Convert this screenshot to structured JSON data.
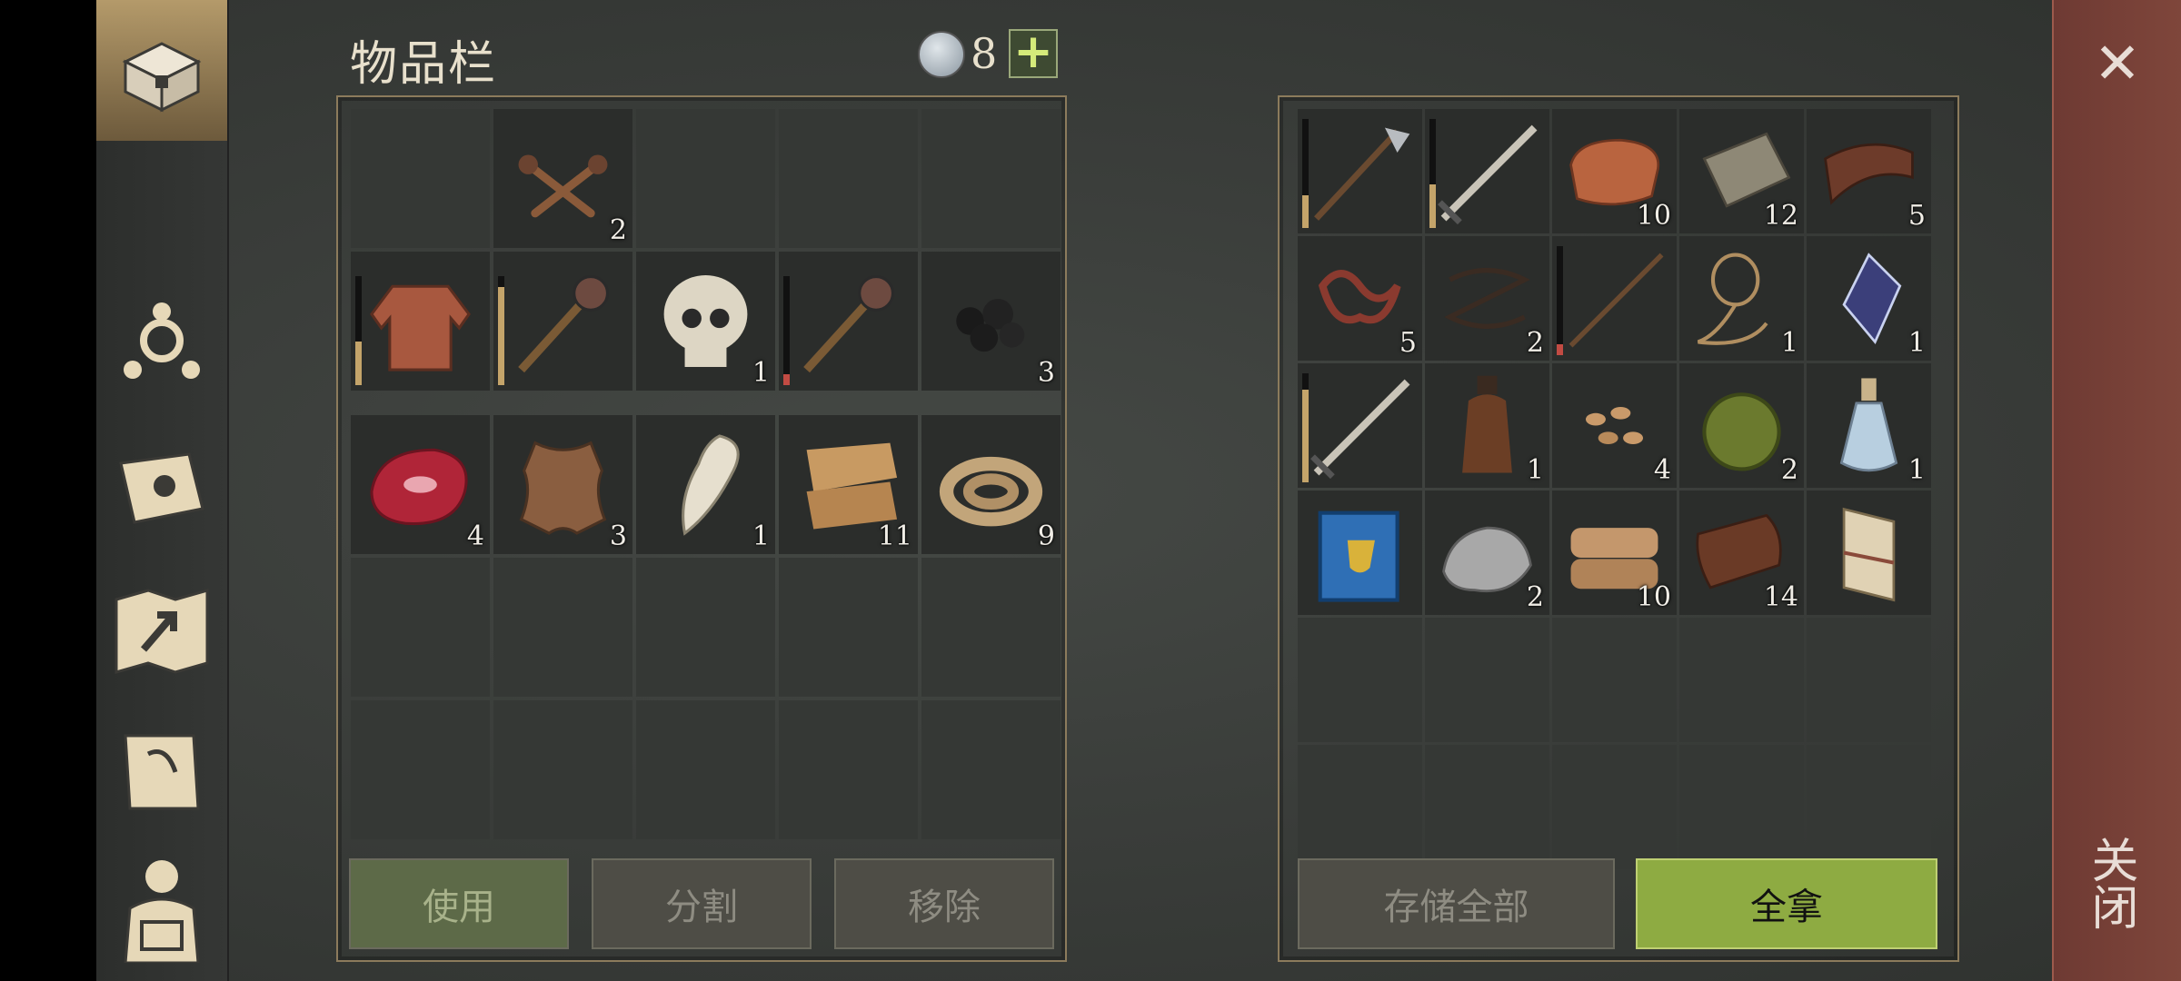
{
  "inventory": {
    "title": "物品栏",
    "currency_count": "8",
    "add_label": "+",
    "equipment_rows": [
      [
        {
          "icon": "empty"
        },
        {
          "icon": "nails-icon",
          "count": "2"
        },
        {
          "icon": "empty"
        },
        {
          "icon": "empty"
        },
        {
          "icon": "empty"
        }
      ],
      [
        {
          "icon": "chainmail-icon",
          "durability": 0.4
        },
        {
          "icon": "mace-icon",
          "durability": 0.9
        },
        {
          "icon": "skull-icon",
          "count": "1"
        },
        {
          "icon": "mace-icon",
          "durability": 0.1,
          "dur_color": "#c24b43"
        },
        {
          "icon": "coal-icon",
          "count": "3"
        }
      ]
    ],
    "bag_rows": [
      [
        {
          "icon": "raw-meat-icon",
          "count": "4"
        },
        {
          "icon": "hide-icon",
          "count": "3"
        },
        {
          "icon": "fang-icon",
          "count": "1"
        },
        {
          "icon": "cloth-icon",
          "count": "11"
        },
        {
          "icon": "rope-icon",
          "count": "9"
        }
      ],
      [
        {
          "icon": "empty"
        },
        {
          "icon": "empty"
        },
        {
          "icon": "empty"
        },
        {
          "icon": "empty"
        },
        {
          "icon": "empty"
        }
      ],
      [
        {
          "icon": "empty"
        },
        {
          "icon": "empty"
        },
        {
          "icon": "empty"
        },
        {
          "icon": "empty"
        },
        {
          "icon": "empty"
        }
      ]
    ],
    "buttons": {
      "use": "使用",
      "split": "分割",
      "remove": "移除"
    }
  },
  "storage": {
    "rows": [
      [
        {
          "icon": "halberd-icon",
          "durability": 0.3
        },
        {
          "icon": "sword-icon",
          "durability": 0.4
        },
        {
          "icon": "copper-ingot-icon",
          "count": "10"
        },
        {
          "icon": "wood-plank-icon",
          "count": "12"
        },
        {
          "icon": "leather-strip-icon",
          "count": "5"
        }
      ],
      [
        {
          "icon": "guts-icon",
          "count": "5"
        },
        {
          "icon": "wire-icon",
          "count": "2"
        },
        {
          "icon": "spear-icon",
          "durability": 0.1,
          "dur_color": "#c24b43"
        },
        {
          "icon": "lasso-icon",
          "count": "1"
        },
        {
          "icon": "crystal-icon",
          "count": "1"
        }
      ],
      [
        {
          "icon": "sword-icon",
          "durability": 0.85
        },
        {
          "icon": "bottle-icon",
          "count": "1"
        },
        {
          "icon": "seeds-icon",
          "count": "4"
        },
        {
          "icon": "herb-ball-icon",
          "count": "2"
        },
        {
          "icon": "potion-icon",
          "count": "1"
        }
      ],
      [
        {
          "icon": "book-icon"
        },
        {
          "icon": "stone-icon",
          "count": "2"
        },
        {
          "icon": "fabric-icon",
          "count": "10"
        },
        {
          "icon": "leather-icon",
          "count": "14"
        },
        {
          "icon": "scroll-icon"
        }
      ],
      [
        {
          "icon": "empty"
        },
        {
          "icon": "empty"
        },
        {
          "icon": "empty"
        },
        {
          "icon": "empty"
        },
        {
          "icon": "empty"
        }
      ],
      [
        {
          "icon": "empty"
        },
        {
          "icon": "empty"
        },
        {
          "icon": "empty"
        },
        {
          "icon": "empty"
        },
        {
          "icon": "empty"
        }
      ]
    ],
    "buttons": {
      "store_all": "存储全部",
      "take_all": "全拿"
    }
  },
  "close": {
    "label": "关闭",
    "icon": "close-icon"
  },
  "sidebar": [
    {
      "icon": "chest-icon",
      "active": true
    },
    {
      "icon": "skills-icon"
    },
    {
      "icon": "journal-icon"
    },
    {
      "icon": "map-icon"
    },
    {
      "icon": "quest-scroll-icon"
    },
    {
      "icon": "character-icon"
    }
  ],
  "colors": {
    "accent": "#8eab42",
    "panel_border": "#8c7b5c",
    "close_bg": "#7a4238"
  }
}
